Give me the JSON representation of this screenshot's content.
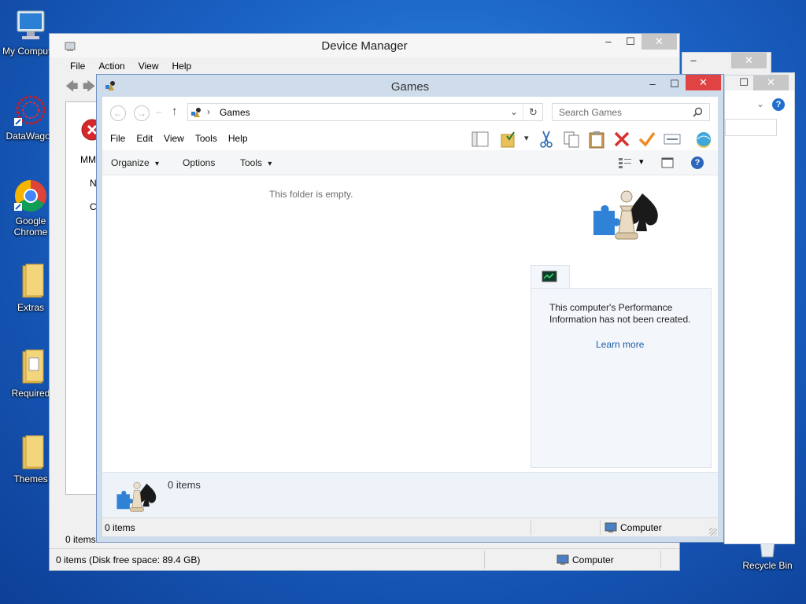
{
  "desktop": {
    "icons": [
      {
        "label": "My Computer"
      },
      {
        "label": "DataWagon"
      },
      {
        "label": "Google Chrome"
      },
      {
        "label": "Extras"
      },
      {
        "label": "Required"
      },
      {
        "label": "Themes"
      },
      {
        "label": "Recycle Bin"
      }
    ]
  },
  "device_manager": {
    "title": "Device Manager",
    "menu": [
      "File",
      "Action",
      "View",
      "Help"
    ],
    "body_fragments": [
      "MM",
      "N",
      "C"
    ],
    "inner_status": "0 items",
    "status": "0 items (Disk free space: 89.4 GB)",
    "status_location": "Computer",
    "caption": {
      "minimize": "–",
      "maximize": "☐",
      "close": "✕"
    }
  },
  "games": {
    "title": "Games",
    "caption": {
      "minimize": "–",
      "maximize": "☐",
      "close": "✕"
    },
    "address": {
      "crumb_sep": "›",
      "location": "Games"
    },
    "search_placeholder": "Search Games",
    "menu": [
      "File",
      "Edit",
      "View",
      "Tools",
      "Help"
    ],
    "commands": {
      "organize": "Organize",
      "options": "Options",
      "tools": "Tools",
      "dropdown_glyph": "▾"
    },
    "empty_message": "This folder is empty.",
    "performance": {
      "message": "This computer's Performance Information has not been created.",
      "link": "Learn more"
    },
    "details_count": "0 items",
    "status_count": "0 items",
    "status_location": "Computer"
  },
  "colors": {
    "accent_close": "#e04343",
    "link": "#1a5fa8",
    "desktop": "#1b63c6"
  }
}
